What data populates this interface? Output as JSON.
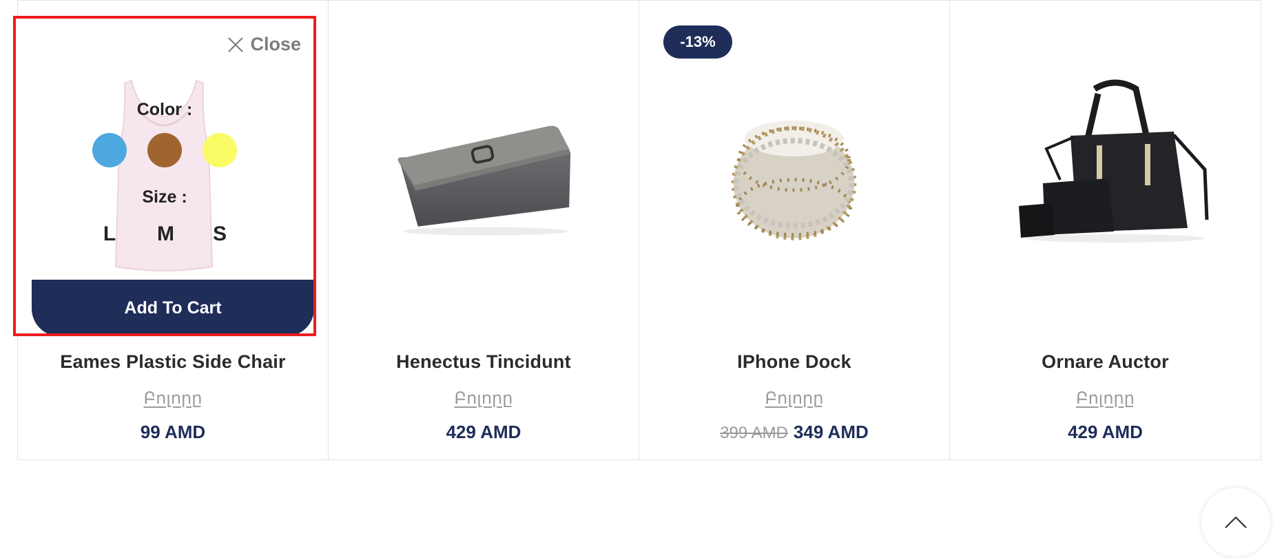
{
  "products": [
    {
      "name": "Eames Plastic Side Chair",
      "brand": "Բոլորը",
      "price": "99 AMD",
      "popup": {
        "close_label": "Close",
        "color_label": "Color :",
        "colors": [
          "#4ea8e0",
          "#a0652f",
          "#fbfb66"
        ],
        "size_label": "Size :",
        "sizes": [
          "L",
          "M",
          "S"
        ],
        "add_to_cart_label": "Add To Cart"
      }
    },
    {
      "name": "Henectus Tincidunt",
      "brand": "Բոլորը",
      "price": "429 AMD"
    },
    {
      "name": "IPhone Dock",
      "brand": "Բոլորը",
      "badge": "-13%",
      "old_price": "399 AMD",
      "price": "349 AMD"
    },
    {
      "name": "Ornare Auctor",
      "brand": "Բոլորը",
      "price": "429 AMD"
    }
  ],
  "colors": {
    "accent": "#1f2d59",
    "highlight_border": "#ee1c1c"
  },
  "icons": {
    "close": "close-icon",
    "scroll_top": "chevron-up-icon"
  }
}
